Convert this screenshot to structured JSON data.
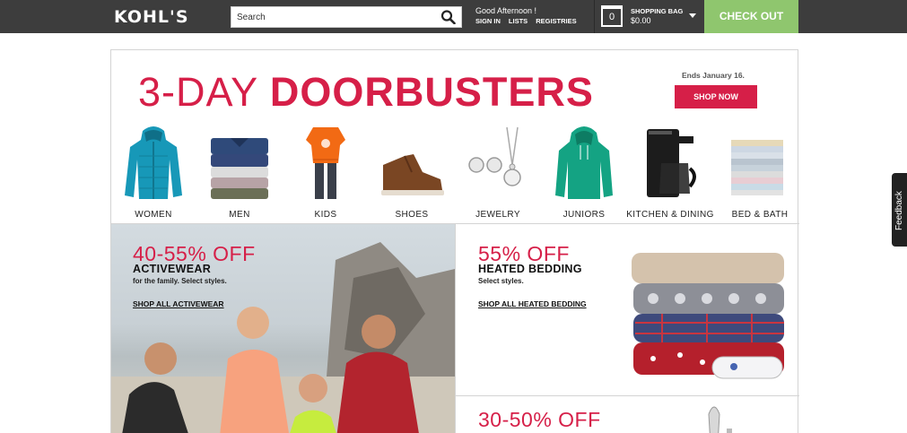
{
  "header": {
    "logo": "KOHL'S",
    "search": {
      "placeholder": "Search"
    },
    "greeting": "Good Afternoon !",
    "account_links": [
      "SIGN IN",
      "LISTS",
      "REGISTRIES"
    ],
    "bag": {
      "count": "0",
      "label": "SHOPPING BAG",
      "total": "$0.00"
    },
    "checkout_label": "CHECK OUT",
    "colors": {
      "bar": "#3d3d3d",
      "checkout": "#8fc66e"
    }
  },
  "hero": {
    "title_light": "3-DAY ",
    "title_bold": "DOORBUSTERS",
    "ends": "Ends January 16.",
    "cta": "SHOP NOW",
    "accent_color": "#d61f48"
  },
  "categories": [
    {
      "label": "WOMEN",
      "icon": "puffer-jacket-icon"
    },
    {
      "label": "MEN",
      "icon": "folded-shirts-icon"
    },
    {
      "label": "KIDS",
      "icon": "kids-outfit-icon"
    },
    {
      "label": "SHOES",
      "icon": "boot-icon"
    },
    {
      "label": "JEWELRY",
      "icon": "earrings-necklace-icon"
    },
    {
      "label": "JUNIORS",
      "icon": "hoodie-icon"
    },
    {
      "label": "KITCHEN & DINING",
      "icon": "coffee-maker-icon"
    },
    {
      "label": "BED & BATH",
      "icon": "towel-stack-icon"
    }
  ],
  "promos": [
    {
      "pct": "40-55% OFF",
      "head": "ACTIVEWEAR",
      "sub": "for the family. Select styles.",
      "link": "SHOP ALL ACTIVEWEAR"
    },
    {
      "pct": "55% OFF",
      "head": "HEATED BEDDING",
      "sub": "Select styles.",
      "link": "SHOP ALL HEATED BEDDING"
    },
    {
      "pct": "30-50% OFF"
    }
  ],
  "feedback_label": "Feedback"
}
